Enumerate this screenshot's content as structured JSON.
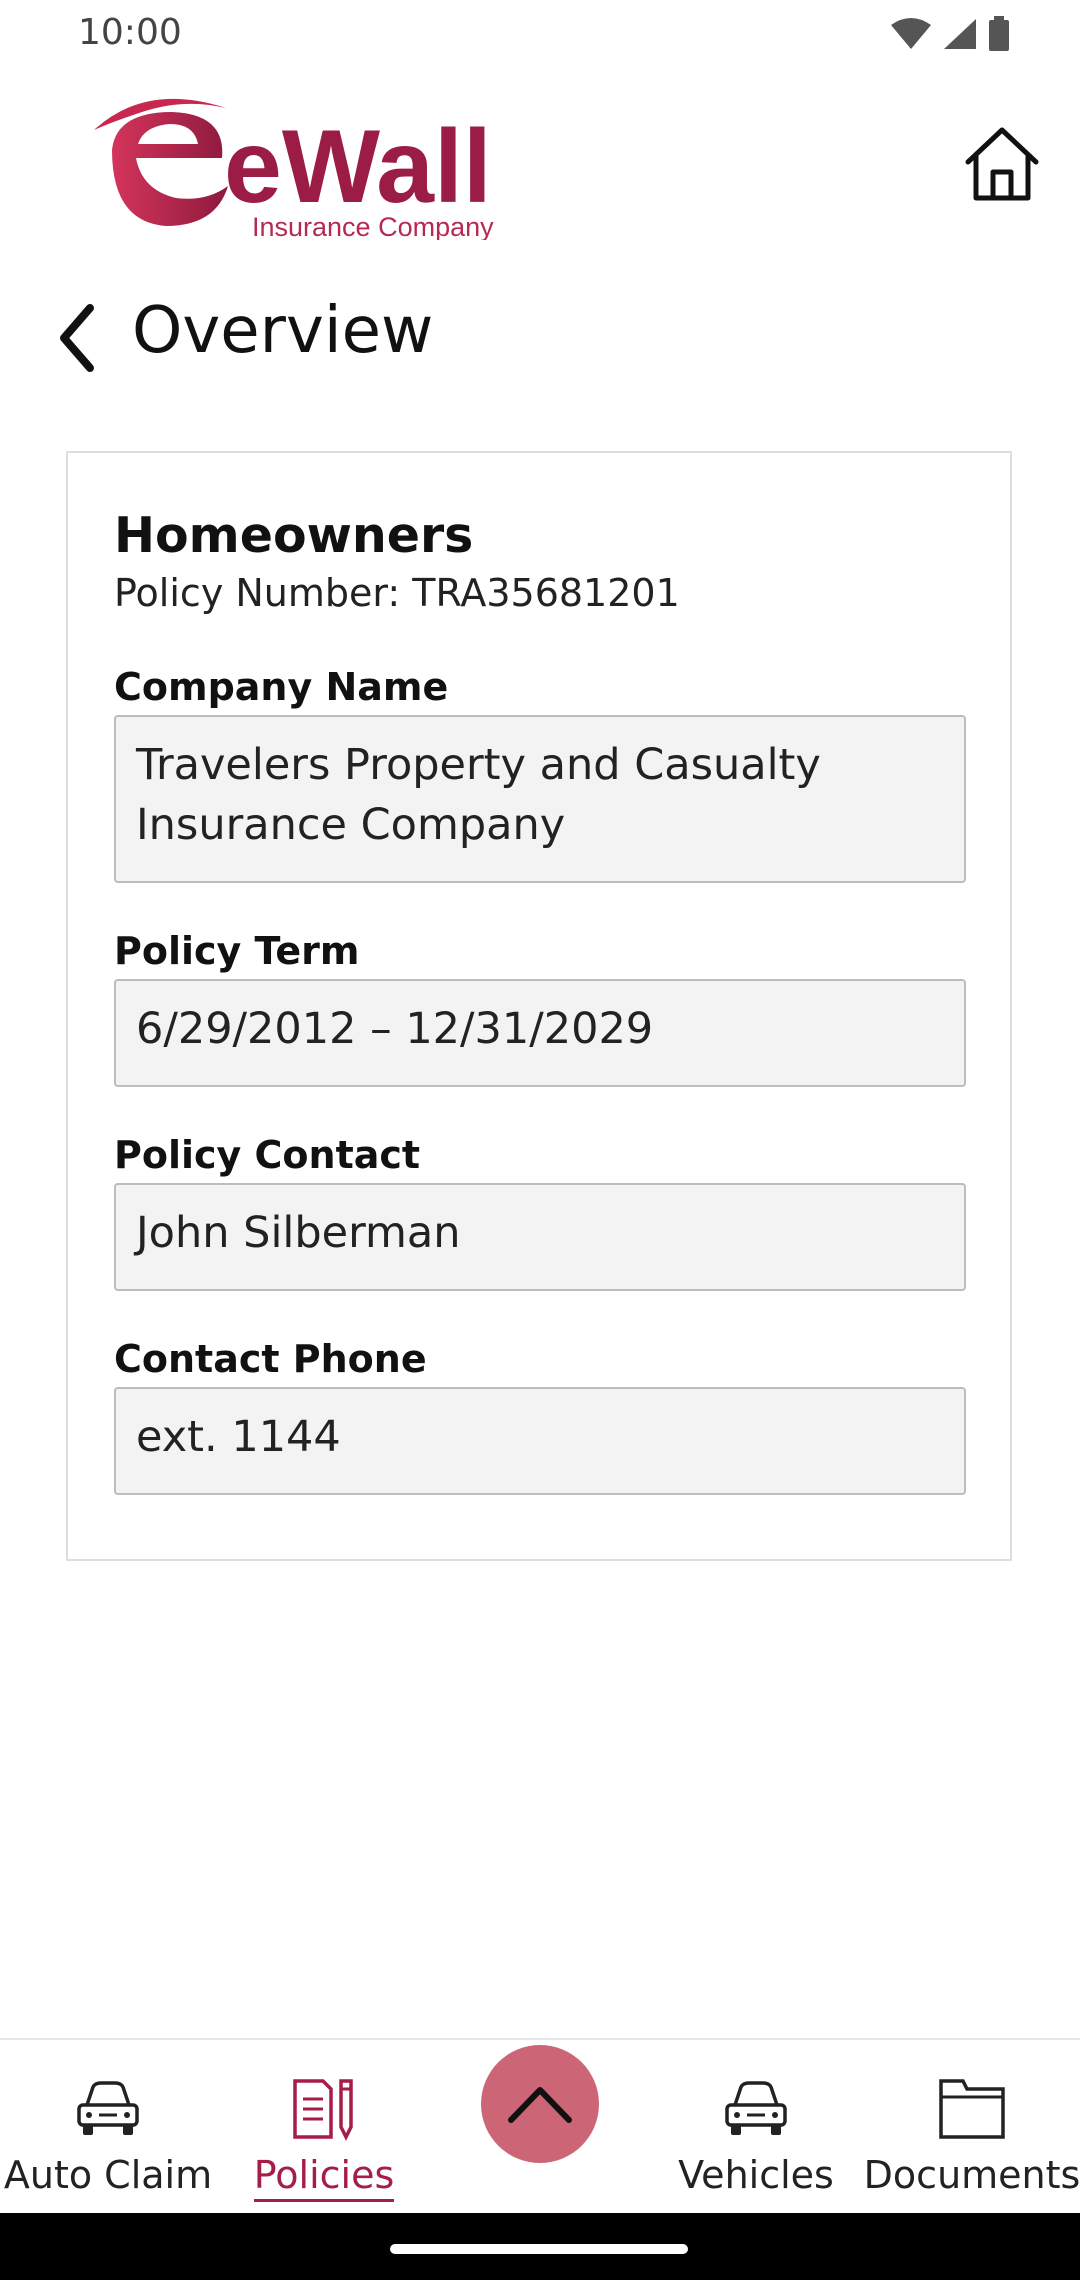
{
  "status_bar": {
    "time": "10:00",
    "icons": [
      "wifi-icon",
      "signal-icon",
      "battery-icon"
    ]
  },
  "header": {
    "logo_text": "eWall",
    "logo_subtitle": "Insurance Company",
    "home_icon": "home-icon"
  },
  "page": {
    "title": "Overview",
    "back_icon": "chevron-left-icon"
  },
  "policy": {
    "type": "Homeowners",
    "number_label": "Policy Number:",
    "number": "TRA35681201",
    "fields": [
      {
        "label": "Company Name",
        "value": "Travelers Property and Casualty Insurance Company"
      },
      {
        "label": "Policy Term",
        "value": "6/29/2012 – 12/31/2029"
      },
      {
        "label": "Policy Contact",
        "value": "John Silberman"
      },
      {
        "label": "Contact Phone",
        "value": "ext. 1144"
      }
    ]
  },
  "bottom_nav": {
    "items": [
      {
        "label": "Auto Claim",
        "icon": "car-icon",
        "active": false
      },
      {
        "label": "Policies",
        "icon": "policies-icon",
        "active": true
      },
      {
        "label": "Vehicles",
        "icon": "car-icon",
        "active": false
      },
      {
        "label": "Documents",
        "icon": "folder-icon",
        "active": false
      }
    ],
    "fab_icon": "chevron-up-icon"
  },
  "colors": {
    "brand": "#a61d47",
    "fab": "#cc6677",
    "field_background": "#f3f3f4",
    "field_border": "#bdbdbd"
  }
}
